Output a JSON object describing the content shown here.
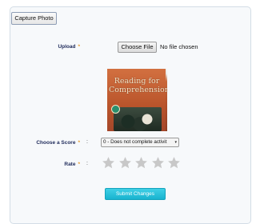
{
  "form": {
    "capture_button": "Capture Photo",
    "upload": {
      "label": "Upload",
      "required_mark": "*",
      "choose_button": "Choose File",
      "status": "No file chosen"
    },
    "cover_image": {
      "title_line1": "Reading for",
      "title_line2": "Comprehension"
    },
    "score": {
      "label": "Choose a Score",
      "required_mark": "*",
      "colon": ":",
      "selected": "0 - Does not complete activit",
      "arrow": "▾"
    },
    "rate": {
      "label": "Rate",
      "required_mark": "*",
      "colon": ":",
      "stars_total": 5,
      "stars_selected": 0,
      "star_color": "#c8c8c8"
    },
    "submit_button": "Submit Changes"
  }
}
